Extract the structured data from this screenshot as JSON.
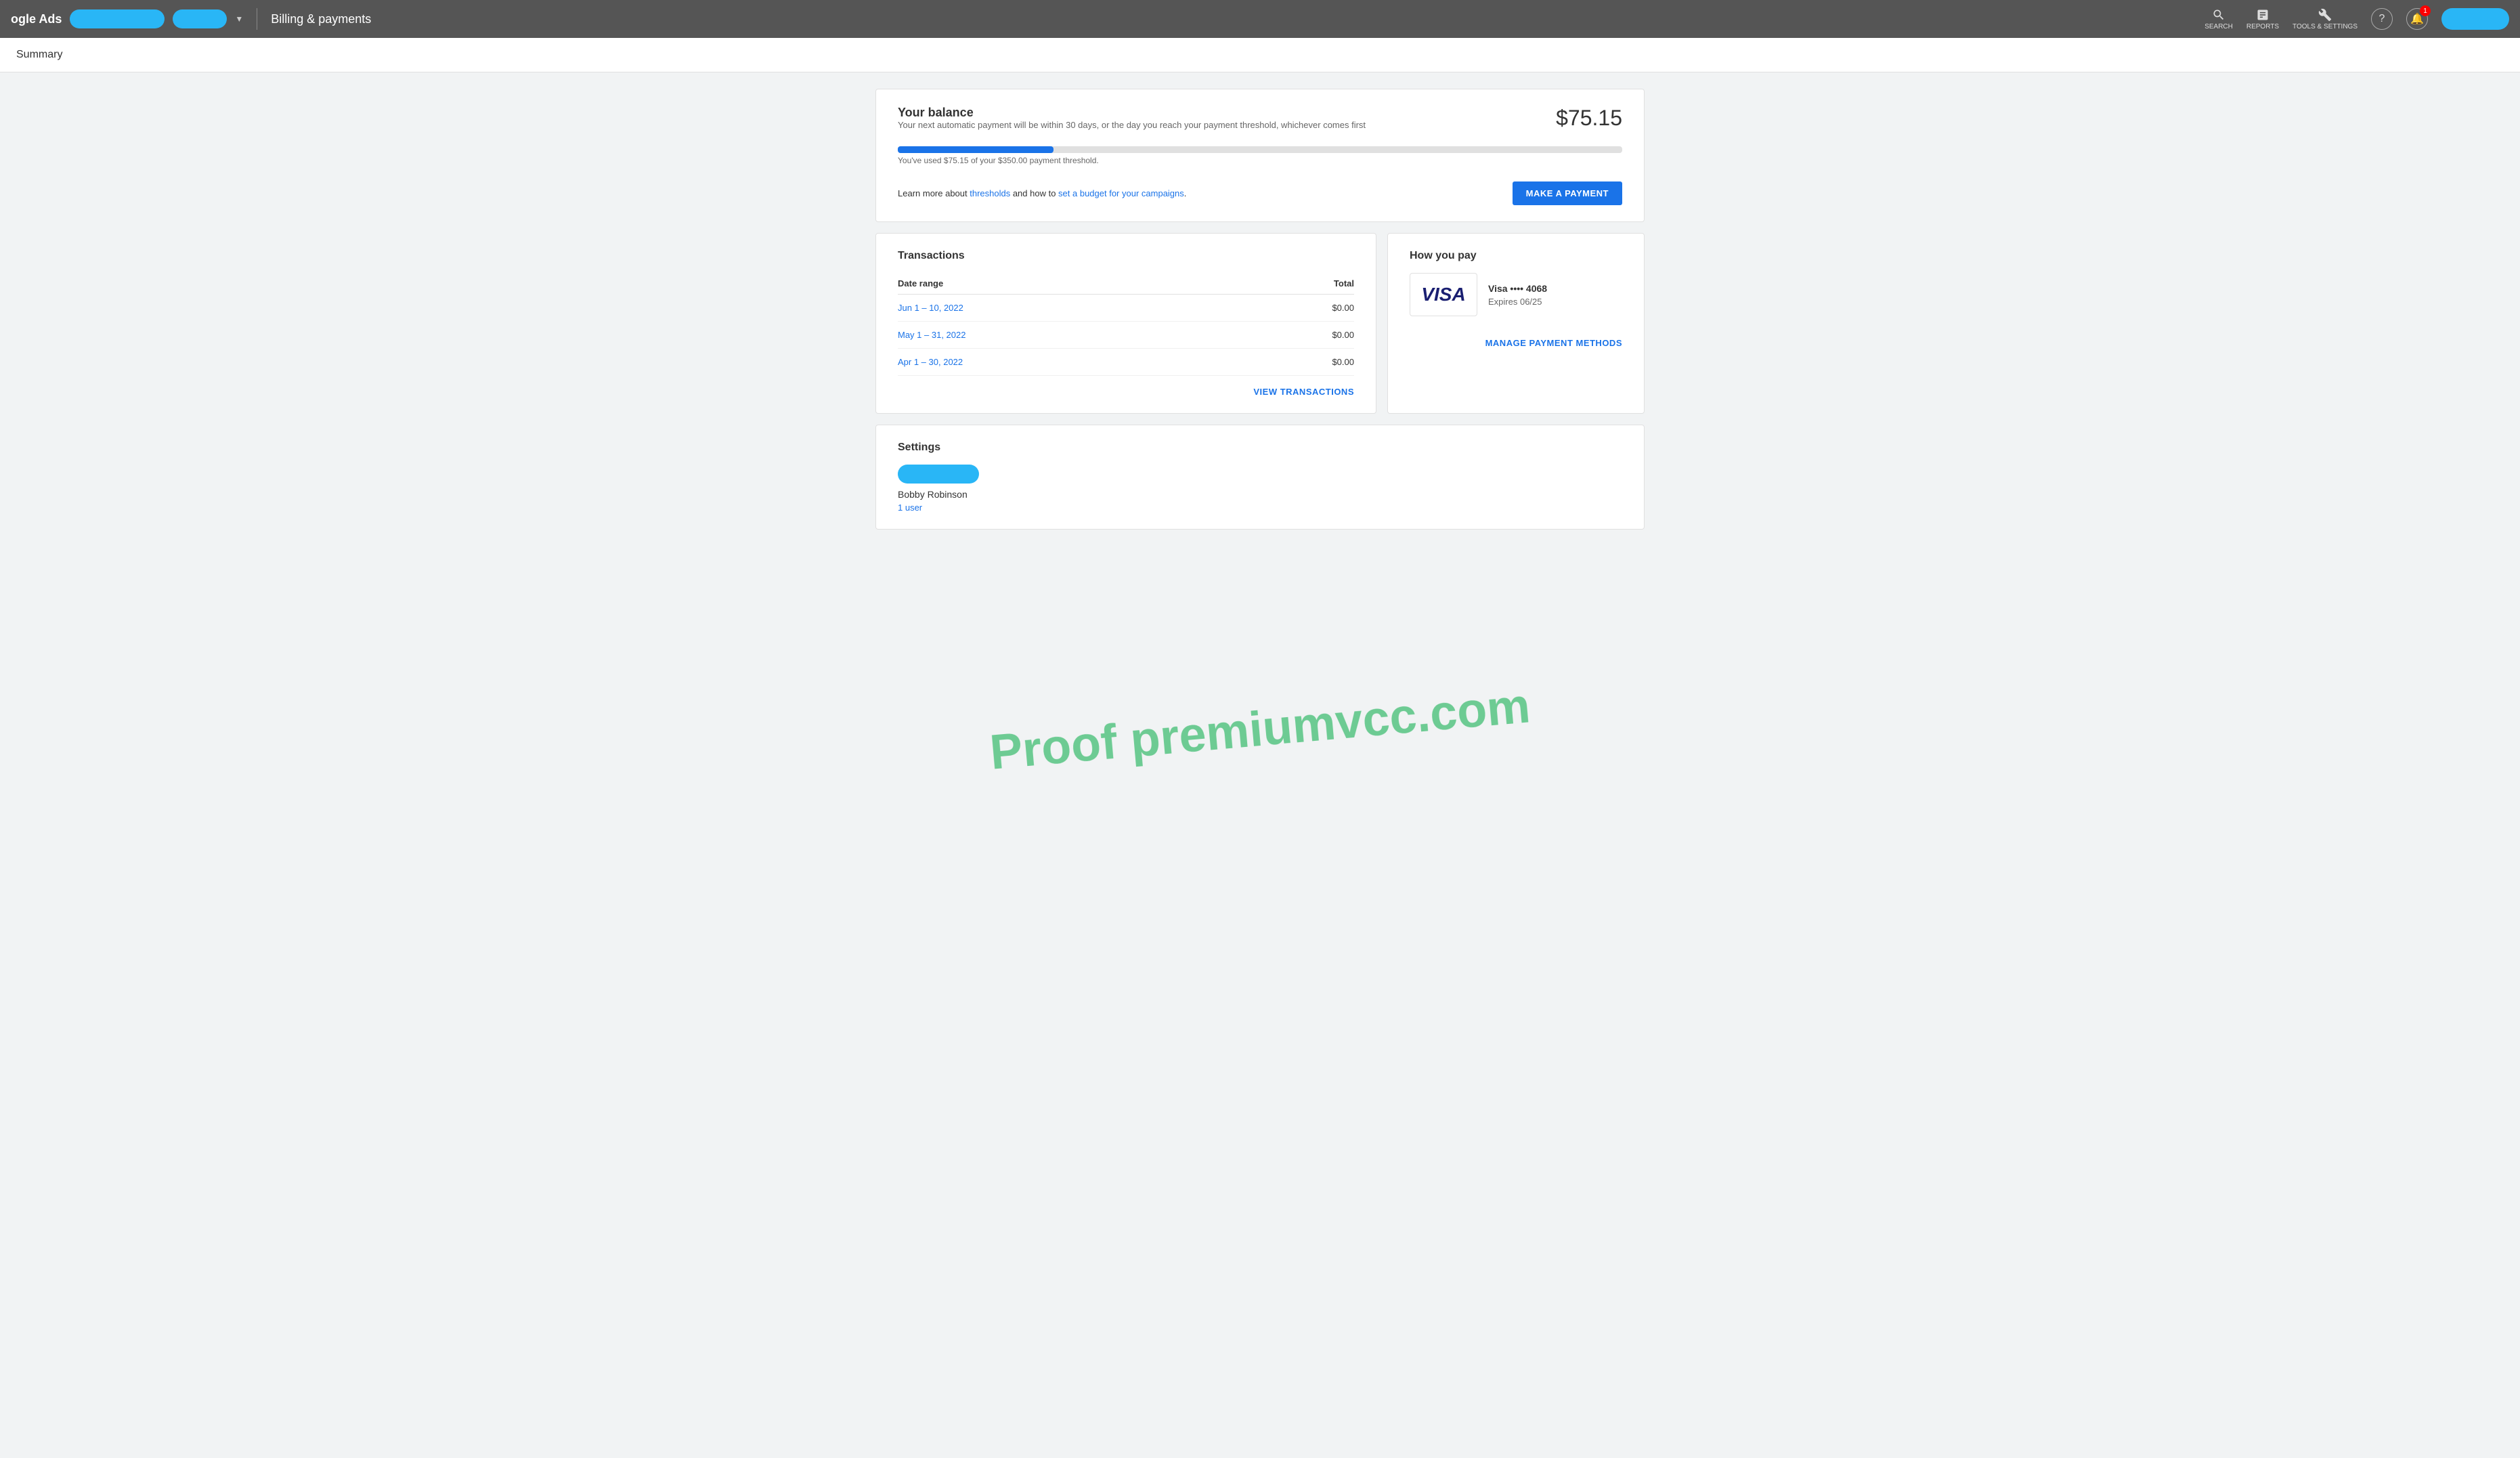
{
  "nav": {
    "brand": "ogle Ads",
    "page_title": "Billing & payments",
    "icons": {
      "search_label": "SEARCH",
      "reports_label": "REPORTS",
      "tools_label": "TOOLS & SETTINGS",
      "notification_count": "1"
    }
  },
  "summary_bar": {
    "title": "Summary"
  },
  "balance_card": {
    "title": "Your balance",
    "subtitle": "Your next automatic payment will be within 30 days, or the day you reach your payment threshold, whichever comes first",
    "amount": "$75.15",
    "progress_text": "You've used $75.15 of your $350.00 payment threshold.",
    "learn_text": "Learn more about ",
    "link1": "thresholds",
    "and_text": " and how to ",
    "link2": "set a budget for your campaigns",
    "period_text": ".",
    "make_payment_btn": "MAKE A PAYMENT",
    "progress_percent": 21.5
  },
  "transactions": {
    "title": "Transactions",
    "col_date": "Date range",
    "col_total": "Total",
    "rows": [
      {
        "date": "Jun 1 – 10, 2022",
        "total": "$0.00"
      },
      {
        "date": "May 1 – 31, 2022",
        "total": "$0.00"
      },
      {
        "date": "Apr 1 – 30, 2022",
        "total": "$0.00"
      }
    ],
    "view_link": "VIEW TRANSACTIONS"
  },
  "how_you_pay": {
    "title": "How you pay",
    "card_name": "Visa •••• 4068",
    "card_expiry": "Expires 06/25",
    "visa_text": "VISA",
    "manage_link": "MANAGE PAYMENT METHODS"
  },
  "settings": {
    "title": "Settings",
    "name": "Bobby Robinson",
    "users": "1 user"
  },
  "watermark": "Proof premiumvcc.com"
}
